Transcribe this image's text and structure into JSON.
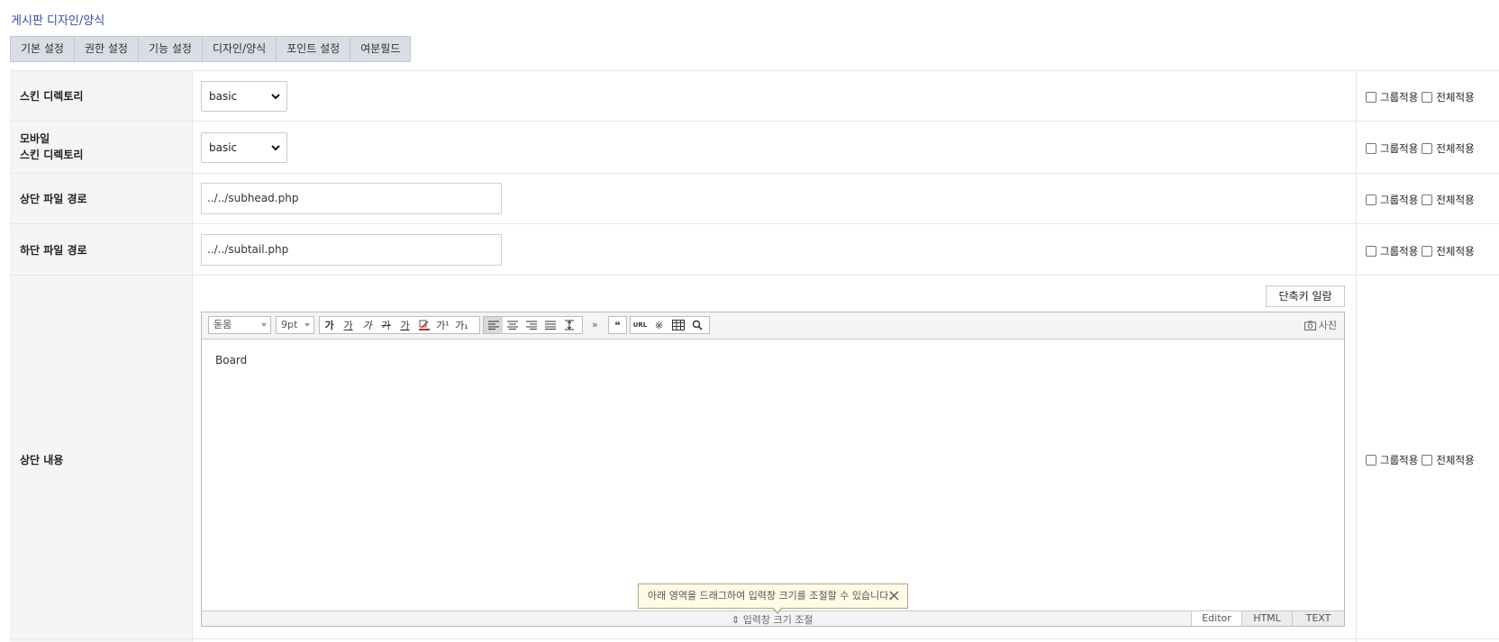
{
  "section_title": "게시판 디자인/양식",
  "tabs": [
    "기본 설정",
    "권한 설정",
    "기능 설정",
    "디자인/양식",
    "포인트 설정",
    "여분필드"
  ],
  "rows": {
    "skin_dir": {
      "label": "스킨 디렉토리",
      "value": "basic"
    },
    "mobile_skin_dir": {
      "label_line1": "모바일",
      "label_line2": "스킨 디렉토리",
      "value": "basic"
    },
    "head_path": {
      "label": "상단 파일 경로",
      "value": "../../subhead.php"
    },
    "tail_path": {
      "label": "하단 파일 경로",
      "value": "../../subtail.php"
    },
    "head_content": {
      "label": "상단 내용"
    }
  },
  "apply": {
    "group": "그룹적용",
    "all": "전체적용"
  },
  "editor": {
    "shortcut_button": "단축키 일람",
    "font_select": "돋움",
    "size_select": "9pt",
    "more": "»",
    "photo": "사진",
    "content": "Board",
    "resize_label": "⇕ 입력창 크기 조절",
    "tooltip": "아래 영역을 드래그하여 입력창 크기를 조절할 수 있습니다.",
    "mode_tabs": [
      "Editor",
      "HTML",
      "TEXT"
    ],
    "toolbar_text": {
      "bold": "가",
      "underline": "가",
      "italic": "가",
      "strike": "가",
      "fontcolor": "가",
      "sup": "가¹",
      "sub": "가₁",
      "url": "URL",
      "quote": "❝",
      "special": "※"
    }
  }
}
